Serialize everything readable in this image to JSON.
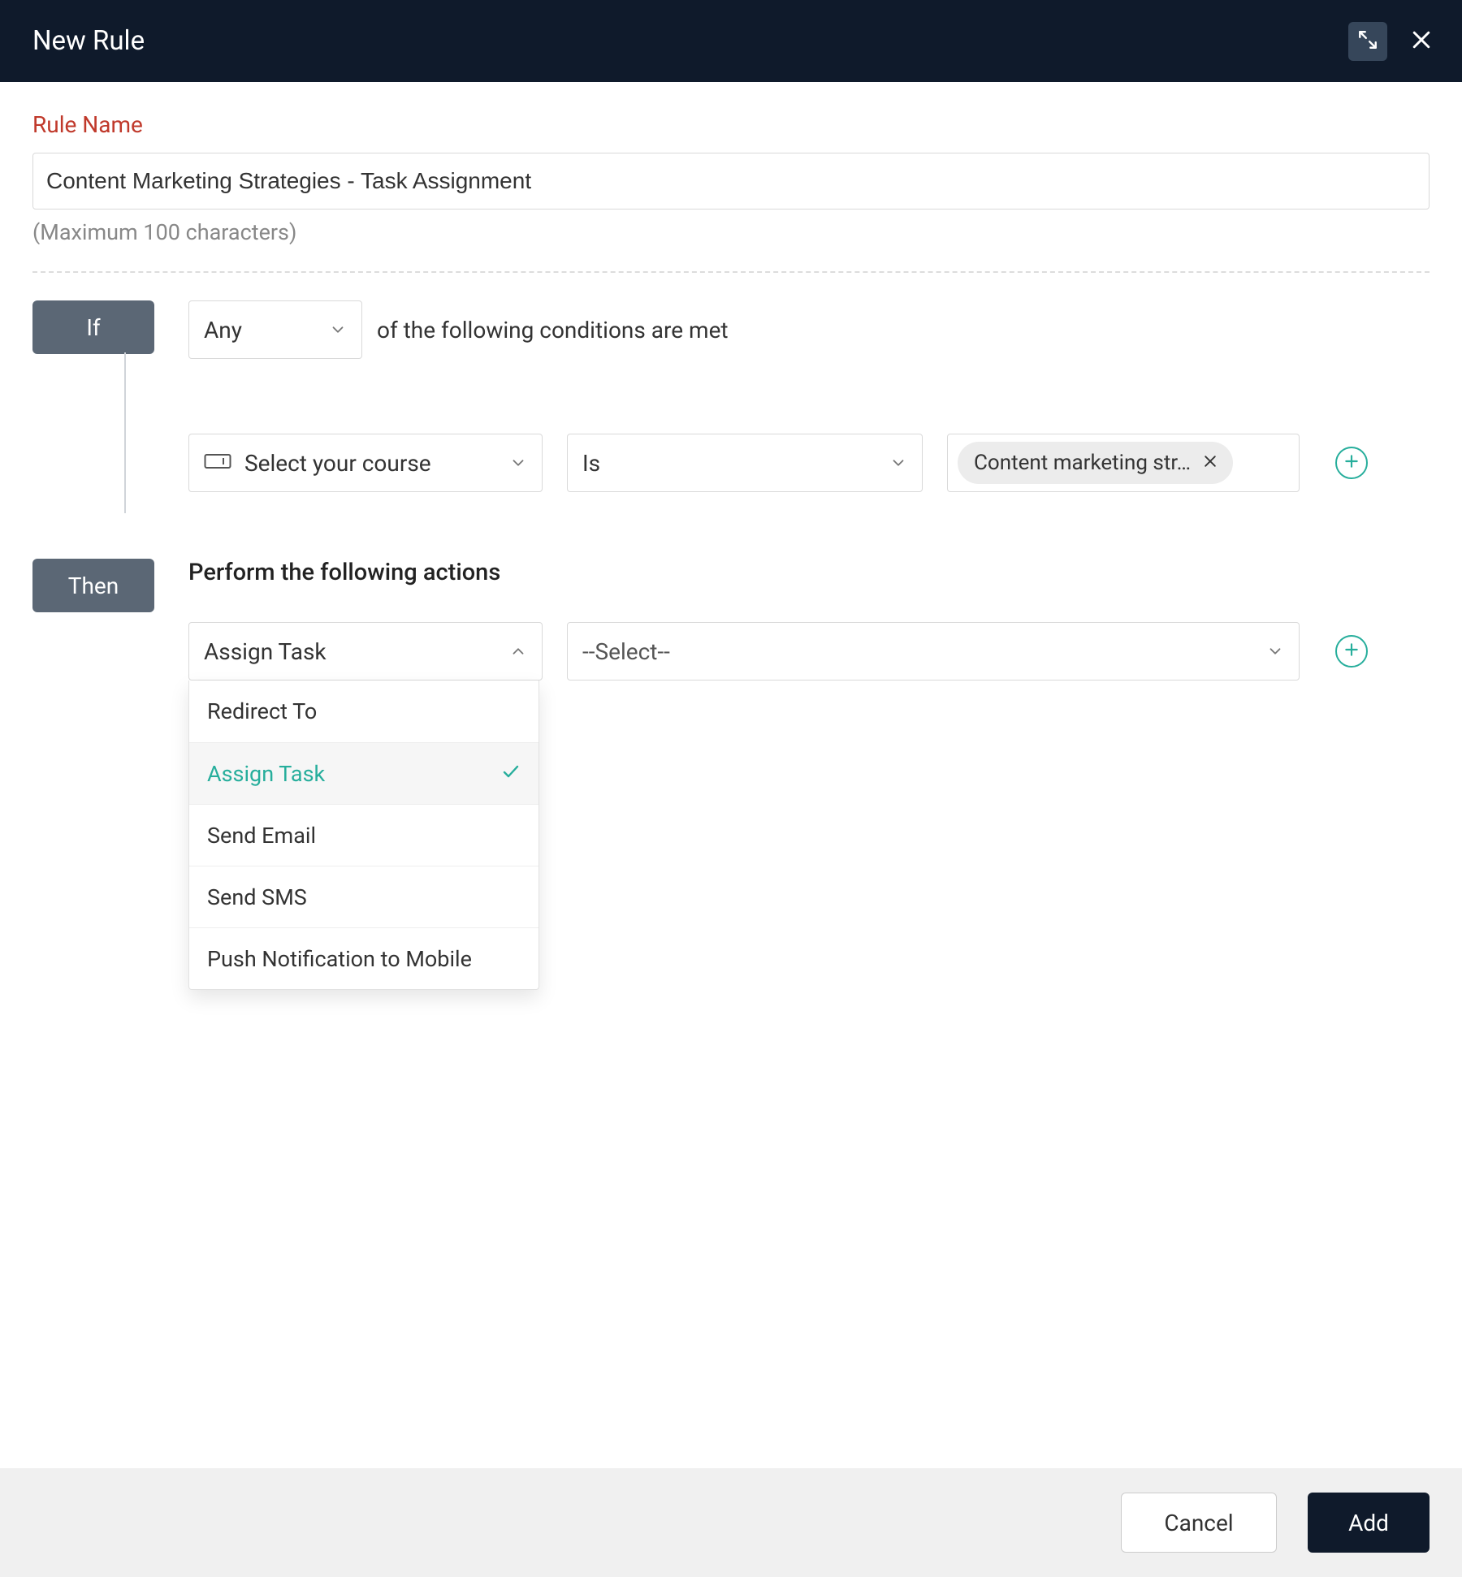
{
  "header": {
    "title": "New Rule"
  },
  "rule_name": {
    "label": "Rule Name",
    "value": "Content Marketing Strategies - Task Assignment",
    "helper": "(Maximum 100 characters)"
  },
  "if": {
    "pill": "If",
    "match_mode": "Any",
    "suffix_text": "of the following conditions are met",
    "condition": {
      "field_label": "Select your course",
      "operator": "Is",
      "value_chip": "Content marketing str…"
    }
  },
  "then": {
    "pill": "Then",
    "heading": "Perform the following actions",
    "action_selected": "Assign Task",
    "target_placeholder": "--Select--",
    "options": {
      "0": "Redirect To",
      "1": "Assign Task",
      "2": "Send Email",
      "3": "Send SMS",
      "4": "Push Notification to Mobile"
    }
  },
  "footer": {
    "cancel": "Cancel",
    "add": "Add"
  }
}
